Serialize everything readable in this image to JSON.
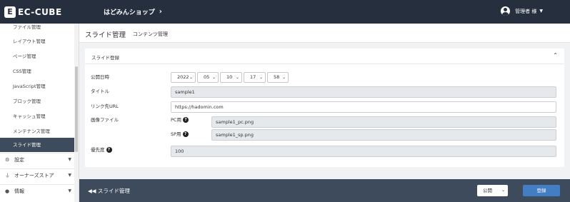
{
  "header": {
    "logo_text": "EC-CUBE",
    "logo_mark": "E",
    "shop_name": "はどみんショップ",
    "shop_chevron": "›",
    "user_name": "管理者 様",
    "user_caret": "▼"
  },
  "sidebar": {
    "items": [
      {
        "label": "ファイル管理"
      },
      {
        "label": "レイアウト管理"
      },
      {
        "label": "ページ管理"
      },
      {
        "label": "CSS管理"
      },
      {
        "label": "JavaScript管理"
      },
      {
        "label": "ブロック管理"
      },
      {
        "label": "キャッシュ管理"
      },
      {
        "label": "メンテナンス管理"
      },
      {
        "label": "スライド管理"
      }
    ],
    "groups": [
      {
        "label": "設定",
        "icon": "⚙",
        "caret": "▼"
      },
      {
        "label": "オーナーズストア",
        "icon": "⏚",
        "caret": "▼"
      },
      {
        "label": "情報",
        "icon": "●",
        "caret": "▼"
      }
    ]
  },
  "page": {
    "title": "スライド管理",
    "subtitle": "コンテンツ管理"
  },
  "card": {
    "title": "スライド登録",
    "collapse_glyph": "⌃"
  },
  "form": {
    "publish_date_label": "公開日時",
    "publish_date": {
      "year": "2022",
      "month": "05",
      "day": "10",
      "hour": "17",
      "minute": "58"
    },
    "title_label": "タイトル",
    "title_value": "sample1",
    "link_label": "リンク先URL",
    "link_value": "https://hadomin.com",
    "image_label": "画像ファイル",
    "pc_label": "PC用",
    "pc_value": "sample1_pc.png",
    "sp_label": "SP用",
    "sp_value": "sample1_sp.png",
    "priority_label": "優先度",
    "priority_value": "100",
    "help_glyph": "?",
    "dropdown_glyph": "⌄"
  },
  "footer": {
    "back_label": "◀◀  スライド管理",
    "status_value": "公開",
    "register_label": "登録"
  }
}
